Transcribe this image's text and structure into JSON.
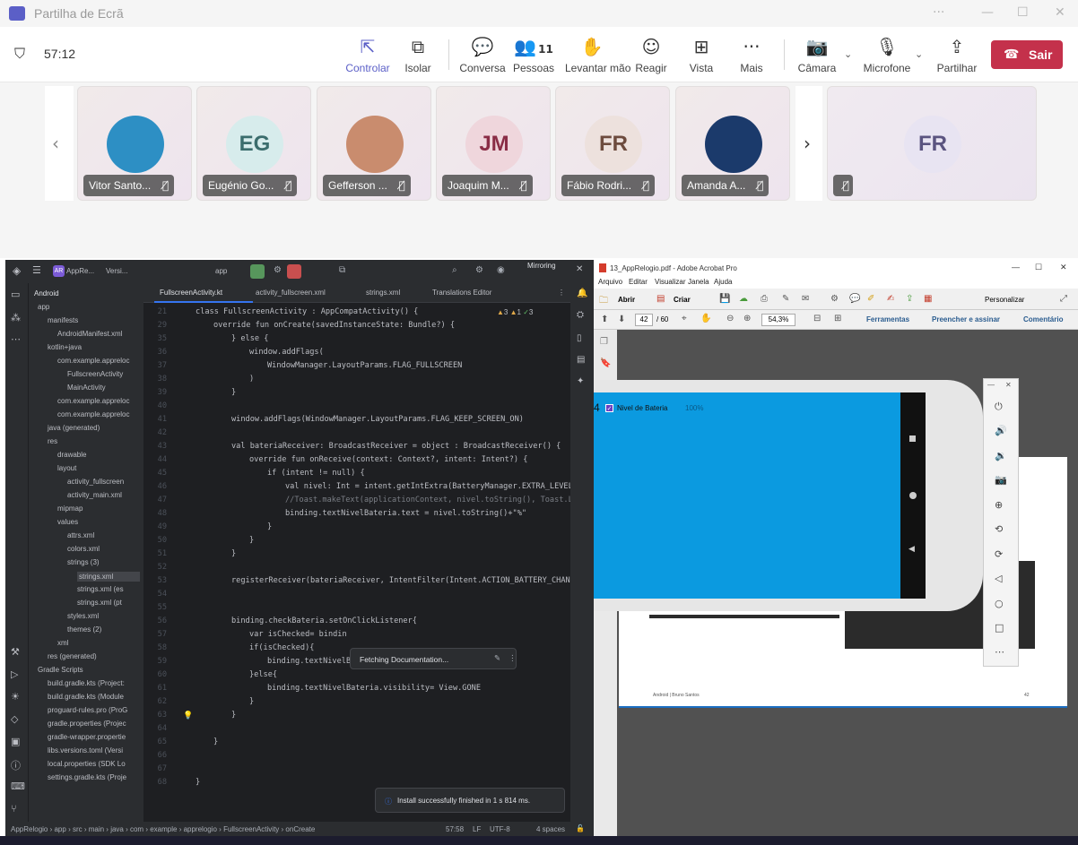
{
  "window": {
    "title": "Partilha de Ecrã",
    "controls": [
      "···",
      "—",
      "☐",
      "✕"
    ]
  },
  "meeting": {
    "timer": "57:12",
    "shield_icon": "shield-icon",
    "buttons": [
      {
        "label": "Controlar",
        "icon": "control-icon",
        "glyph": "⇱"
      },
      {
        "label": "Isolar",
        "icon": "popout-icon",
        "glyph": "⧉"
      },
      {
        "label": "Conversa",
        "icon": "chat-icon",
        "glyph": "💬"
      },
      {
        "label": "Pessoas",
        "icon": "people-icon",
        "glyph": "👥",
        "count": "11"
      },
      {
        "label": "Levantar mão",
        "icon": "raise-hand-icon",
        "glyph": "✋"
      },
      {
        "label": "Reagir",
        "icon": "react-icon",
        "glyph": "☺"
      },
      {
        "label": "Vista",
        "icon": "view-icon",
        "glyph": "⊞"
      },
      {
        "label": "Mais",
        "icon": "more-icon",
        "glyph": "···"
      },
      {
        "label": "Câmara",
        "icon": "camera-off-icon",
        "glyph": "📷"
      },
      {
        "label": "Microfone",
        "icon": "mic-off-icon",
        "glyph": "🎙"
      },
      {
        "label": "Partilhar",
        "icon": "share-icon",
        "glyph": "⇪"
      }
    ],
    "leave_label": "Sair",
    "accent": "#5b5fc7",
    "leave_color": "#c4314b"
  },
  "participants": [
    {
      "name": "Vitor Santo...",
      "initials": "",
      "avatar_color": "#2d8fc4"
    },
    {
      "name": "Eugénio Go...",
      "initials": "EG",
      "avatar_color": "#d7ecec"
    },
    {
      "name": "Gefferson ...",
      "initials": "",
      "avatar_color": "#c98c6e"
    },
    {
      "name": "Joaquim M...",
      "initials": "JM",
      "avatar_color": "#efd6dc"
    },
    {
      "name": "Fábio Rodri...",
      "initials": "FR",
      "avatar_color": "#ede1dd"
    },
    {
      "name": "Amanda A...",
      "initials": "",
      "avatar_color": "#1b3a6b"
    },
    {
      "name": "",
      "initials": "FR",
      "avatar_color": "#e8e4f2"
    }
  ],
  "ide": {
    "project_badge": "AR",
    "project_name": "AppRe...",
    "version_menu": "Versi...",
    "run_config": "app",
    "mirroring_label": "Mirroring",
    "project_view": "Android",
    "tabs": [
      "FullscreenActivity.kt",
      "activity_fullscreen.xml",
      "strings.xml",
      "Translations Editor"
    ],
    "inspections": [
      "3",
      "1",
      "3"
    ],
    "tree": [
      {
        "label": "app",
        "indent": 0
      },
      {
        "label": "manifests",
        "indent": 1
      },
      {
        "label": "AndroidManifest.xml",
        "indent": 2
      },
      {
        "label": "kotlin+java",
        "indent": 1
      },
      {
        "label": "com.example.appreloc",
        "indent": 2
      },
      {
        "label": "FullscreenActivity",
        "indent": 3
      },
      {
        "label": "MainActivity",
        "indent": 3
      },
      {
        "label": "com.example.appreloc",
        "indent": 2
      },
      {
        "label": "com.example.appreloc",
        "indent": 2
      },
      {
        "label": "java (generated)",
        "indent": 1
      },
      {
        "label": "res",
        "indent": 1
      },
      {
        "label": "drawable",
        "indent": 2
      },
      {
        "label": "layout",
        "indent": 2
      },
      {
        "label": "activity_fullscreen",
        "indent": 3
      },
      {
        "label": "activity_main.xml",
        "indent": 3
      },
      {
        "label": "mipmap",
        "indent": 2
      },
      {
        "label": "values",
        "indent": 2
      },
      {
        "label": "attrs.xml",
        "indent": 3
      },
      {
        "label": "colors.xml",
        "indent": 3
      },
      {
        "label": "strings (3)",
        "indent": 3
      },
      {
        "label": "strings.xml",
        "indent": 4
      },
      {
        "label": "strings.xml (es",
        "indent": 4
      },
      {
        "label": "strings.xml (pt",
        "indent": 4
      },
      {
        "label": "styles.xml",
        "indent": 3
      },
      {
        "label": "themes (2)",
        "indent": 3
      },
      {
        "label": "xml",
        "indent": 2
      },
      {
        "label": "res (generated)",
        "indent": 1
      },
      {
        "label": "Gradle Scripts",
        "indent": 0
      },
      {
        "label": "build.gradle.kts (Project:",
        "indent": 1
      },
      {
        "label": "build.gradle.kts (Module",
        "indent": 1
      },
      {
        "label": "proguard-rules.pro (ProG",
        "indent": 1
      },
      {
        "label": "gradle.properties (Projec",
        "indent": 1
      },
      {
        "label": "gradle-wrapper.propertie",
        "indent": 1
      },
      {
        "label": "libs.versions.toml (Versi",
        "indent": 1
      },
      {
        "label": "local.properties (SDK Lo",
        "indent": 1
      },
      {
        "label": "settings.gradle.kts (Proje",
        "indent": 1
      }
    ],
    "code": [
      {
        "n": "21",
        "indent": 0,
        "t": "class FullscreenActivity : AppCompatActivity() {"
      },
      {
        "n": "29",
        "indent": 1,
        "t": "override fun onCreate(savedInstanceState: Bundle?) {"
      },
      {
        "n": "35",
        "indent": 2,
        "t": "} else {"
      },
      {
        "n": "36",
        "indent": 3,
        "t": "window.addFlags("
      },
      {
        "n": "37",
        "indent": 4,
        "t": "WindowManager.LayoutParams.FLAG_FULLSCREEN"
      },
      {
        "n": "38",
        "indent": 3,
        "t": ")"
      },
      {
        "n": "39",
        "indent": 2,
        "t": "}"
      },
      {
        "n": "40",
        "indent": 0,
        "t": ""
      },
      {
        "n": "41",
        "indent": 2,
        "t": "window.addFlags(WindowManager.LayoutParams.FLAG_KEEP_SCREEN_ON)"
      },
      {
        "n": "42",
        "indent": 0,
        "t": ""
      },
      {
        "n": "43",
        "indent": 2,
        "t": "val bateriaReceiver: BroadcastReceiver = object : BroadcastReceiver() {"
      },
      {
        "n": "44",
        "indent": 3,
        "t": "override fun onReceive(context: Context?, intent: Intent?) {"
      },
      {
        "n": "45",
        "indent": 4,
        "t": "if (intent != null) {"
      },
      {
        "n": "46",
        "indent": 5,
        "t": "val nivel: Int = intent.getIntExtra(BatteryManager.EXTRA_LEVEL"
      },
      {
        "n": "47",
        "indent": 5,
        "t": "//Toast.makeText(applicationContext, nivel.toString(), Toast.LE"
      },
      {
        "n": "48",
        "indent": 5,
        "t": "binding.textNivelBateria.text = nivel.toString()+\"%\""
      },
      {
        "n": "49",
        "indent": 4,
        "t": "}"
      },
      {
        "n": "50",
        "indent": 3,
        "t": "}"
      },
      {
        "n": "51",
        "indent": 2,
        "t": "}"
      },
      {
        "n": "52",
        "indent": 0,
        "t": ""
      },
      {
        "n": "53",
        "indent": 2,
        "t": "registerReceiver(bateriaReceiver, IntentFilter(Intent.ACTION_BATTERY_CHANGE"
      },
      {
        "n": "54",
        "indent": 0,
        "t": ""
      },
      {
        "n": "55",
        "indent": 0,
        "t": ""
      },
      {
        "n": "56",
        "indent": 2,
        "t": "binding.checkBateria.setOnClickListener{"
      },
      {
        "n": "57",
        "indent": 3,
        "t": "var isChecked= bindin"
      },
      {
        "n": "58",
        "indent": 3,
        "t": "if(isChecked){"
      },
      {
        "n": "59",
        "indent": 4,
        "t": "binding.textNivelBateria.visibility= View.VISIBLE"
      },
      {
        "n": "60",
        "indent": 3,
        "t": "}else{"
      },
      {
        "n": "61",
        "indent": 4,
        "t": "binding.textNivelBateria.visibility= View.GONE"
      },
      {
        "n": "62",
        "indent": 3,
        "t": "}"
      },
      {
        "n": "63",
        "indent": 2,
        "t": "}"
      },
      {
        "n": "64",
        "indent": 0,
        "t": ""
      },
      {
        "n": "65",
        "indent": 1,
        "t": "}"
      },
      {
        "n": "66",
        "indent": 0,
        "t": ""
      },
      {
        "n": "67",
        "indent": 0,
        "t": ""
      },
      {
        "n": "68",
        "indent": 0,
        "t": "}"
      }
    ],
    "popup": "Fetching Documentation...",
    "notification": "Install successfully finished in 1 s 814 ms.",
    "breadcrumb": [
      "AppRelogio",
      "app",
      "src",
      "main",
      "java",
      "com",
      "example",
      "apprelogio",
      "FullscreenActivity",
      "onCreate"
    ],
    "status": {
      "position": "57:58",
      "line_sep": "LF",
      "encoding": "UTF-8",
      "indent": "4 spaces"
    }
  },
  "acrobat": {
    "title": "13_AppRelogio.pdf - Adobe Acrobat Pro",
    "menu": [
      "Arquivo",
      "Editar",
      "Visualizar",
      "Janela",
      "Ajuda"
    ],
    "open_label": "Abrir",
    "create_label": "Criar",
    "customize_label": "Personalizar",
    "page_current": "42",
    "page_total": "/ 60",
    "zoom": "54,3%",
    "tools": [
      "Ferramentas",
      "Preencher e assinar",
      "Comentário"
    ],
    "footer_left": "Android | Bruno Santos",
    "footer_page": "42",
    "page_num_partial": "4"
  },
  "emulator": {
    "checkbox_label": "Nivel de Bateria",
    "battery_value": "100%",
    "screen_color": "#0b9ae0"
  }
}
